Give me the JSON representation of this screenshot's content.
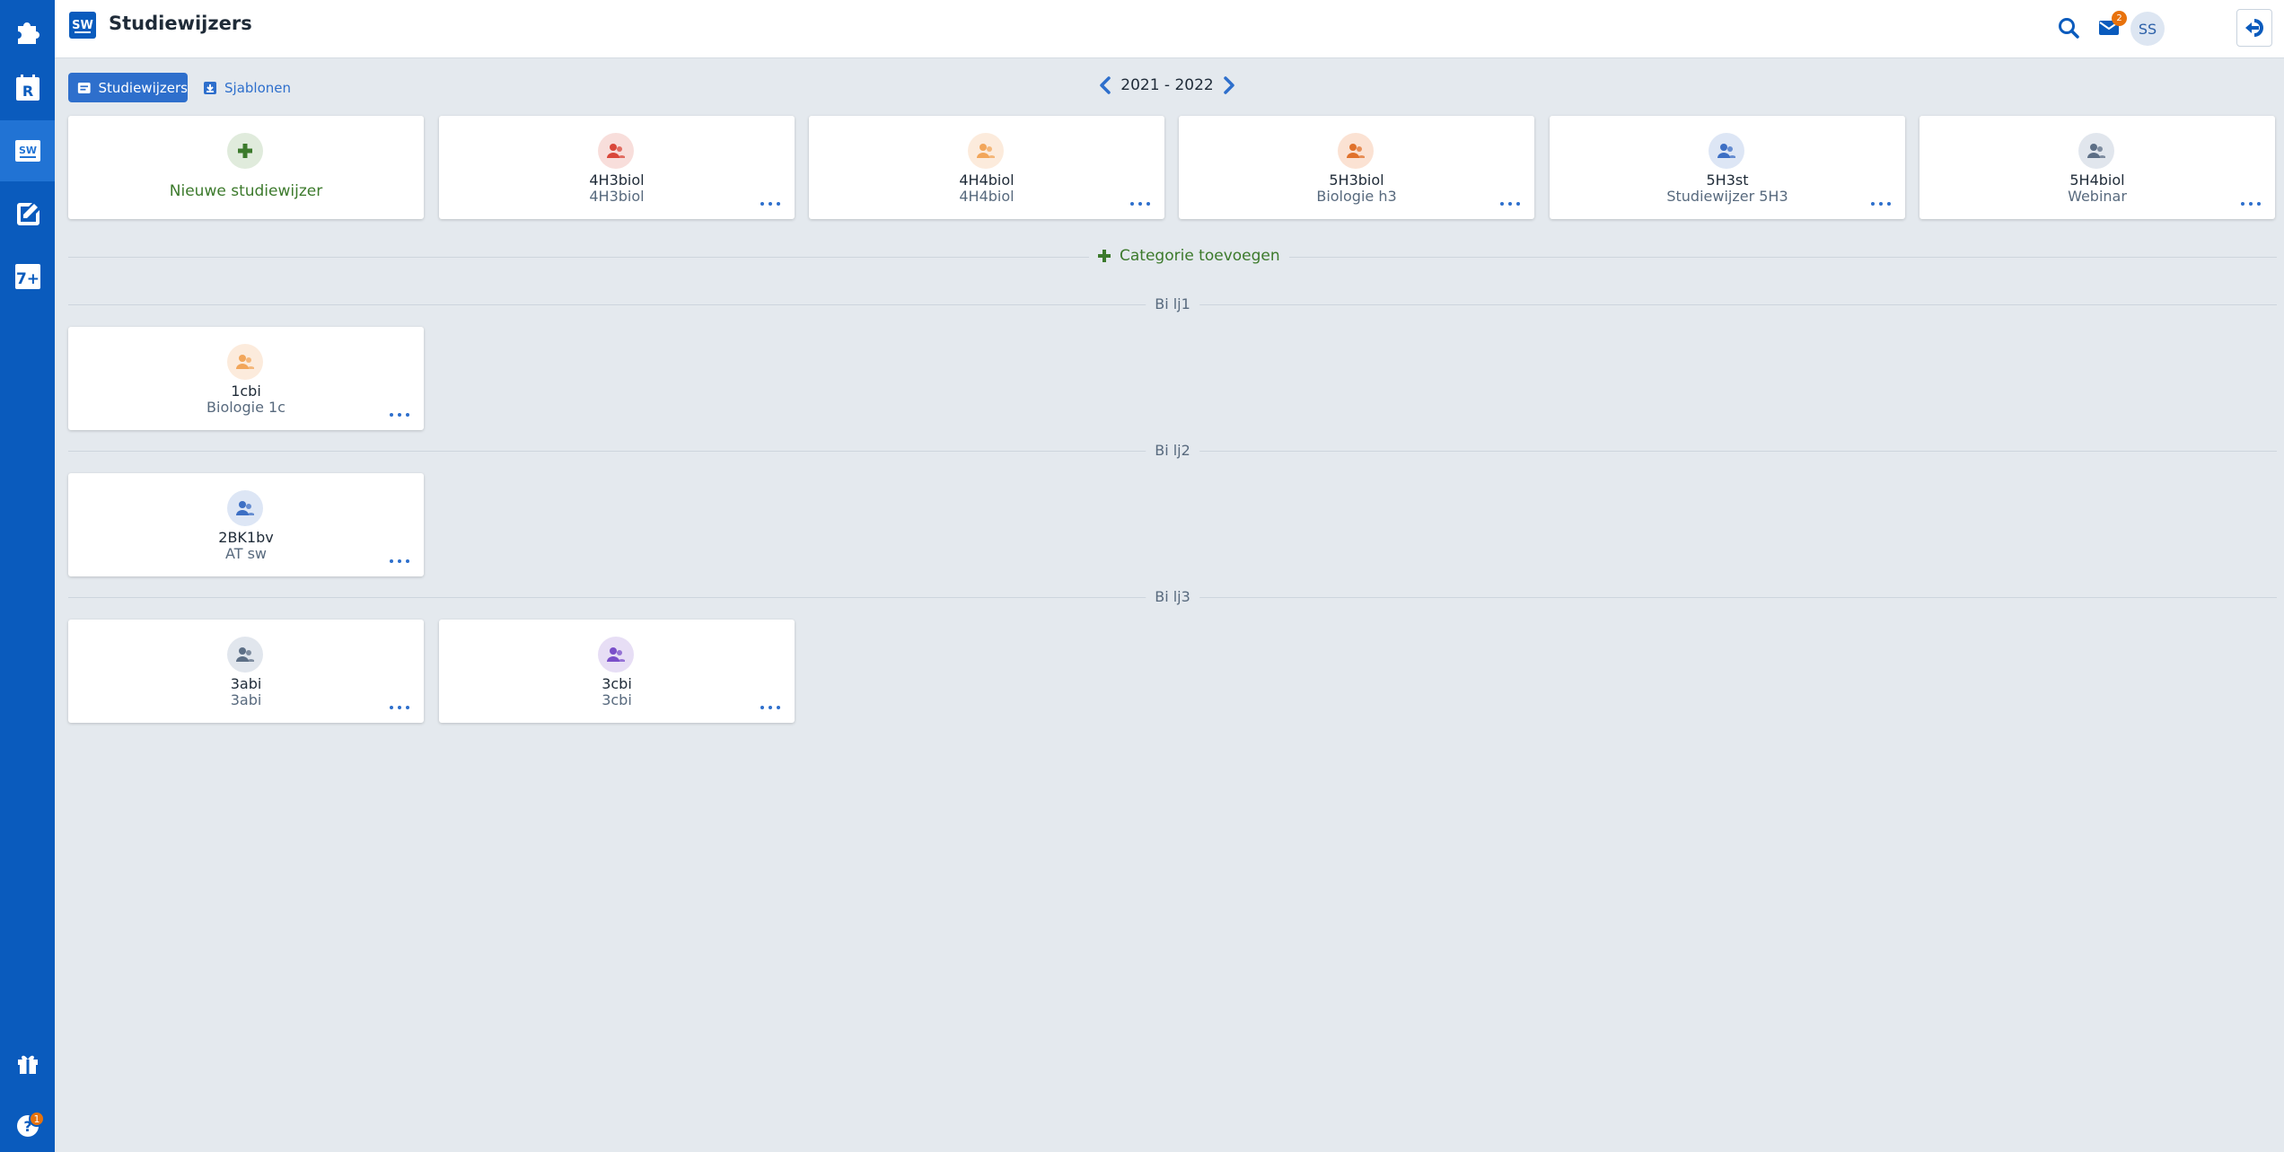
{
  "header": {
    "app_logo": "SW",
    "title": "Studiewijzers",
    "mail_count": "2",
    "avatar_initials": "SS"
  },
  "rail": {
    "items": [
      "puzzle-icon",
      "rooster-icon",
      "studiewijzer-icon",
      "edit-icon",
      "seven-plus-icon",
      "gift-icon",
      "help-icon"
    ],
    "rooster_letter": "R",
    "sw_letters": "SW",
    "seven": "7+",
    "help_badge": "1"
  },
  "toolbar": {
    "tab_studiewijzers": "Studiewijzers",
    "tab_sjablonen": "Sjablonen",
    "year": "2021 - 2022"
  },
  "new_card": {
    "label": "Nieuwe studiewijzer"
  },
  "top_cards": [
    {
      "name": "4H3biol",
      "sub": "4H3biol",
      "color": "#d9473a",
      "bg": "#f8dedb"
    },
    {
      "name": "4H4biol",
      "sub": "4H4biol",
      "color": "#f2a65a",
      "bg": "#fcebdc"
    },
    {
      "name": "5H3biol",
      "sub": "Biologie h3",
      "color": "#e0722c",
      "bg": "#fbe2d3"
    },
    {
      "name": "5H3st",
      "sub": "Studiewijzer 5H3",
      "color": "#3d6fc4",
      "bg": "#dde6f5"
    },
    {
      "name": "5H4biol",
      "sub": "Webinar",
      "color": "#5d6f86",
      "bg": "#e1e6ed"
    }
  ],
  "add_category": "Categorie toevoegen",
  "categories": [
    {
      "label": "Bi lj1",
      "cards": [
        {
          "name": "1cbi",
          "sub": "Biologie 1c",
          "color": "#f2a65a",
          "bg": "#fcebdc"
        }
      ]
    },
    {
      "label": "Bi lj2",
      "cards": [
        {
          "name": "2BK1bv",
          "sub": "AT sw",
          "color": "#3d6fc4",
          "bg": "#dde6f5"
        }
      ]
    },
    {
      "label": "Bi lj3",
      "cards": [
        {
          "name": "3abi",
          "sub": "3abi",
          "color": "#5d6f86",
          "bg": "#e1e6ed"
        },
        {
          "name": "3cbi",
          "sub": "3cbi",
          "color": "#7a4fc9",
          "bg": "#e7def5"
        }
      ]
    }
  ]
}
